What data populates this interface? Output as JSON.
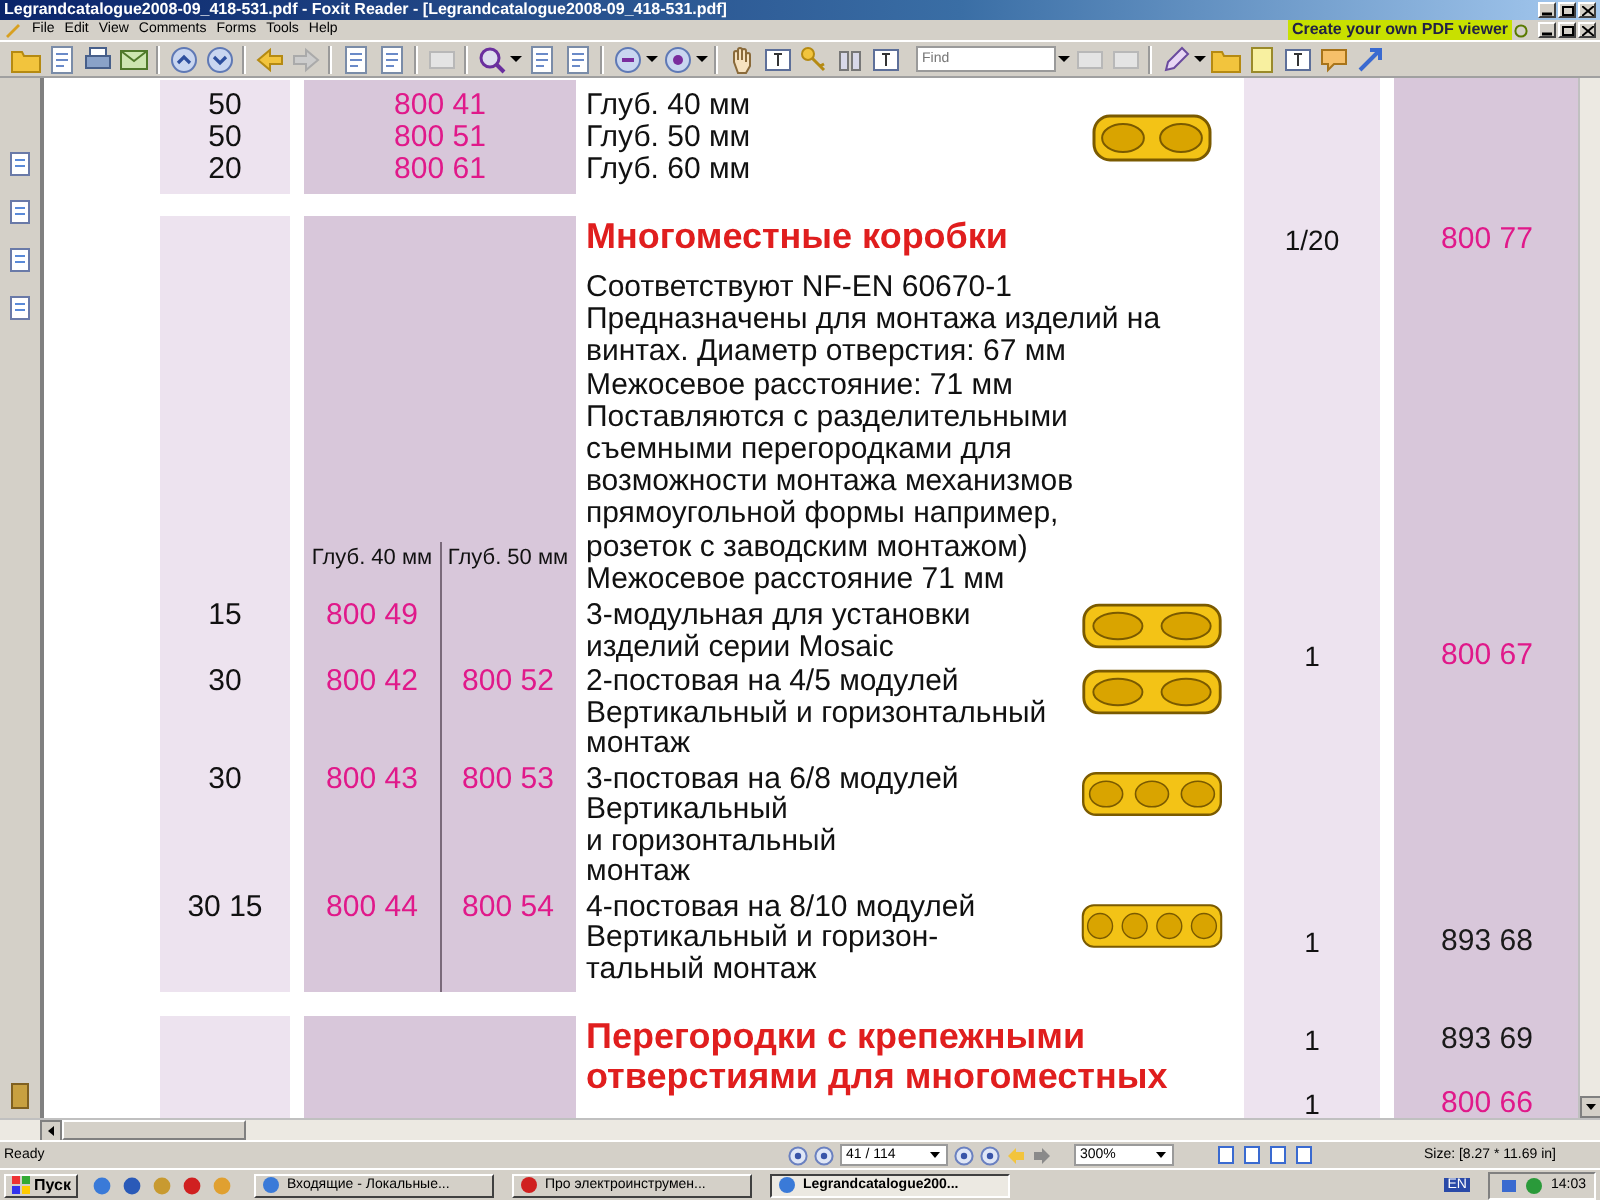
{
  "window": {
    "title": "Legrandcatalogue2008-09_418-531.pdf - Foxit Reader - [Legrandcatalogue2008-09_418-531.pdf]"
  },
  "menu": {
    "items": [
      "File",
      "Edit",
      "View",
      "Comments",
      "Forms",
      "Tools",
      "Help"
    ],
    "promo": "Create your own PDF viewer"
  },
  "toolbar": {
    "find": {
      "placeholder": "Find"
    }
  },
  "page": {
    "top_rows": [
      {
        "qty": "50",
        "ref": "800 41",
        "text": "Глуб. 40 мм"
      },
      {
        "qty": "50",
        "ref": "800 51",
        "text": "Глуб. 50 мм"
      },
      {
        "qty": "20",
        "ref": "800 61",
        "text": "Глуб. 60 мм"
      }
    ],
    "section": {
      "heading": "Многоместные коробки",
      "intro": "Соответствуют NF-EN 60670-1\nПредназначены для монтажа изделий на\nвинтах. Диаметр отверстия: 67 мм\nМежосевое расстояние: 71 мм\nПоставляются с разделительными\nсъемными перегородками для\nвозможности монтажа механизмов\nпрямоугольной формы например,\nрозеток с заводским монтажом)\nМежосевое расстояние 71 мм",
      "depth_headers": [
        "Глуб. 40 мм",
        "Глуб. 50 мм"
      ],
      "rows": [
        {
          "qty": "15",
          "refs": [
            "800 49"
          ],
          "text": "3-модульная для установки\nизделий серии Mosaic"
        },
        {
          "qty": "30",
          "refs": [
            "800 42",
            "800 52"
          ],
          "text": "2-постовая на 4/5 модулей\nВертикальный и горизонтальный\nмонтаж"
        },
        {
          "qty": "30",
          "refs": [
            "800 43",
            "800 53"
          ],
          "text": "3-постовая на 6/8 модулей\nВертикальный\nи горизонтальный\nмонтаж"
        },
        {
          "qty": "30 15",
          "refs": [
            "800 44",
            "800 54"
          ],
          "text": "4-постовая на 8/10 модулей\nВертикальный и горизон-\nтальный монтаж"
        }
      ]
    },
    "next_heading": "Перегородки с крепежными\nотверстиями для многоместных",
    "side_rows": [
      {
        "qty": "1/20",
        "ref": "800 77",
        "color": "#e0198a"
      },
      {
        "qty": "1",
        "ref": "800 67",
        "color": "#e0198a"
      },
      {
        "qty": "1",
        "ref": "893 68",
        "color": "#1a1a1a"
      },
      {
        "qty": "1",
        "ref": "893 69",
        "color": "#1a1a1a"
      },
      {
        "qty": "1",
        "ref": "800 66",
        "color": "#e0198a"
      }
    ]
  },
  "status_bar": {
    "text": "Ready",
    "page": "41 / 114",
    "zoom": "300%",
    "size": "Size: [8.27 * 11.69 in]"
  },
  "taskbar": {
    "start": "Пуск",
    "tasks": [
      {
        "label": "Входящие - Локальные...",
        "selected": false
      },
      {
        "label": "Про электроинструмен...",
        "selected": false
      },
      {
        "label": "Legrandcatalogue200...",
        "selected": true
      }
    ],
    "language": "EN",
    "clock": "14:03"
  }
}
